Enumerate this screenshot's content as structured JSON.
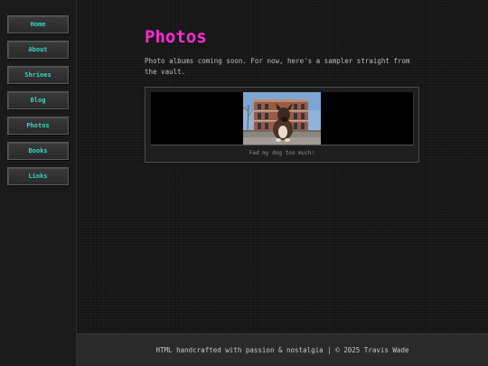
{
  "nav": {
    "items": [
      {
        "label": "Home"
      },
      {
        "label": "About"
      },
      {
        "label": "Shrines"
      },
      {
        "label": "Blog"
      },
      {
        "label": "Photos"
      },
      {
        "label": "Books"
      },
      {
        "label": "Links"
      }
    ]
  },
  "main": {
    "title": "Photos",
    "intro": "Photo albums coming soon. For now, here's a sampler straight from the vault.",
    "album": {
      "caption": "Fed my dog too much!"
    }
  },
  "footer": {
    "text": "HTML handcrafted with passion & nostalgia | © 2025 Travis Wade"
  },
  "colors": {
    "accent_title": "#ff2bd9",
    "nav_text": "#35d6c8",
    "background": "#151515"
  }
}
